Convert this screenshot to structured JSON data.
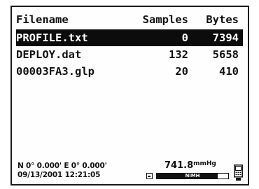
{
  "table": {
    "headers": {
      "filename": "Filename",
      "samples": "Samples",
      "bytes": "Bytes"
    },
    "rows": [
      {
        "filename": "PROFILE.txt",
        "samples": "0",
        "bytes": "7394",
        "selected": true
      },
      {
        "filename": "DEPLOY.dat",
        "samples": "132",
        "bytes": "5658",
        "selected": false
      },
      {
        "filename": "00003FA3.glp",
        "samples": "20",
        "bytes": "410",
        "selected": false
      }
    ]
  },
  "status": {
    "coordinates": "N 0° 0.000' E 0° 0.000'",
    "datetime": "09/13/2001 12:21:05",
    "pressure_value": "741.8",
    "pressure_unit": "mmHg",
    "battery_label": "NiMH",
    "battery_level": 0.85
  },
  "icons": {
    "battery": "battery-icon",
    "device": "handheld-device-icon"
  }
}
